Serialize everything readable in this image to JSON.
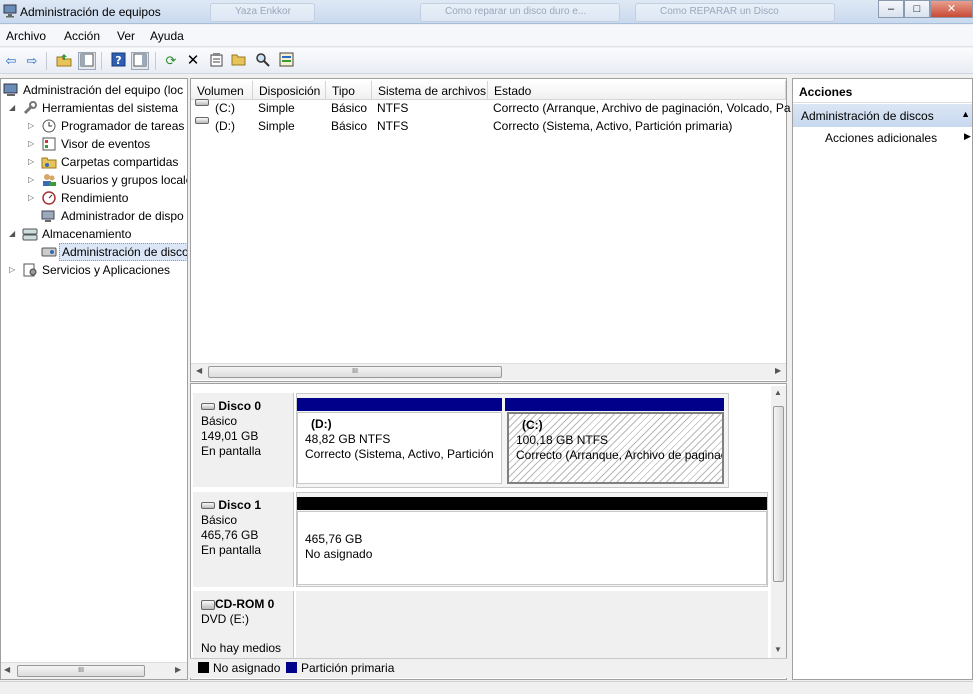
{
  "window": {
    "title": "Administración de equipos",
    "background_tabs": [
      "Yaza Enkkor",
      "Como reparar un disco duro e...",
      "Como REPARAR un Disco"
    ],
    "buttons": {
      "minimize": "–",
      "maximize": "□",
      "close": "✕"
    }
  },
  "menu": {
    "items": [
      "Archivo",
      "Acción",
      "Ver",
      "Ayuda"
    ]
  },
  "toolbar": {
    "icons": [
      "back-arrow-icon",
      "forward-arrow-icon",
      "up-folder-icon",
      "show-hide-console-tree-icon",
      "help-icon",
      "show-hide-action-pane-icon",
      "refresh-icon",
      "delete-icon",
      "properties-icon",
      "open-folder-icon",
      "search-icon",
      "export-icon"
    ]
  },
  "tree": {
    "root": "Administración del equipo (loc",
    "system_tools": "Herramientas del sistema",
    "task_scheduler": "Programador de tareas",
    "event_viewer": "Visor de eventos",
    "shared_folders": "Carpetas compartidas",
    "local_users": "Usuarios y grupos locale",
    "performance": "Rendimiento",
    "device_manager": "Administrador de dispo",
    "storage": "Almacenamiento",
    "disk_management": "Administración de disco",
    "services_apps": "Servicios y Aplicaciones",
    "scroll_glyph": "III"
  },
  "volumes": {
    "columns": [
      "Volumen",
      "Disposición",
      "Tipo",
      "Sistema de archivos",
      "Estado"
    ],
    "rows": [
      {
        "volume": "(C:)",
        "layout": "Simple",
        "type": "Básico",
        "fs": "NTFS",
        "status": "Correcto (Arranque, Archivo de paginación, Volcado, Pa"
      },
      {
        "volume": "(D:)",
        "layout": "Simple",
        "type": "Básico",
        "fs": "NTFS",
        "status": "Correcto (Sistema, Activo, Partición primaria)"
      }
    ],
    "scroll_glyph": "III"
  },
  "disks": [
    {
      "name": "Disco 0",
      "kind": "Básico",
      "size": "149,01 GB",
      "state": "En pantalla",
      "partitions": [
        {
          "label": "(D:)",
          "size_fs": "48,82 GB NTFS",
          "status": "Correcto (Sistema, Activo, Partición"
        },
        {
          "label": "(C:)",
          "size_fs": "100,18 GB NTFS",
          "status": "Correcto (Arranque, Archivo de paginac"
        }
      ]
    },
    {
      "name": "Disco 1",
      "kind": "Básico",
      "size": "465,76 GB",
      "state": "En pantalla",
      "partitions": [
        {
          "label": "",
          "size_fs": "465,76 GB",
          "status": "No asignado"
        }
      ]
    },
    {
      "name": "CD-ROM 0",
      "kind": "DVD (E:)",
      "size": "",
      "state": "No hay medios"
    }
  ],
  "legend": [
    {
      "label": "No asignado",
      "color": "#000000"
    },
    {
      "label": "Partición primaria",
      "color": "#00008b"
    }
  ],
  "actions": {
    "header": "Acciones",
    "section": "Administración de discos",
    "more": "Acciones adicionales"
  },
  "colors": {
    "primary_partition": "#00008b",
    "unallocated": "#000000",
    "selection": "#dbe7f6"
  }
}
